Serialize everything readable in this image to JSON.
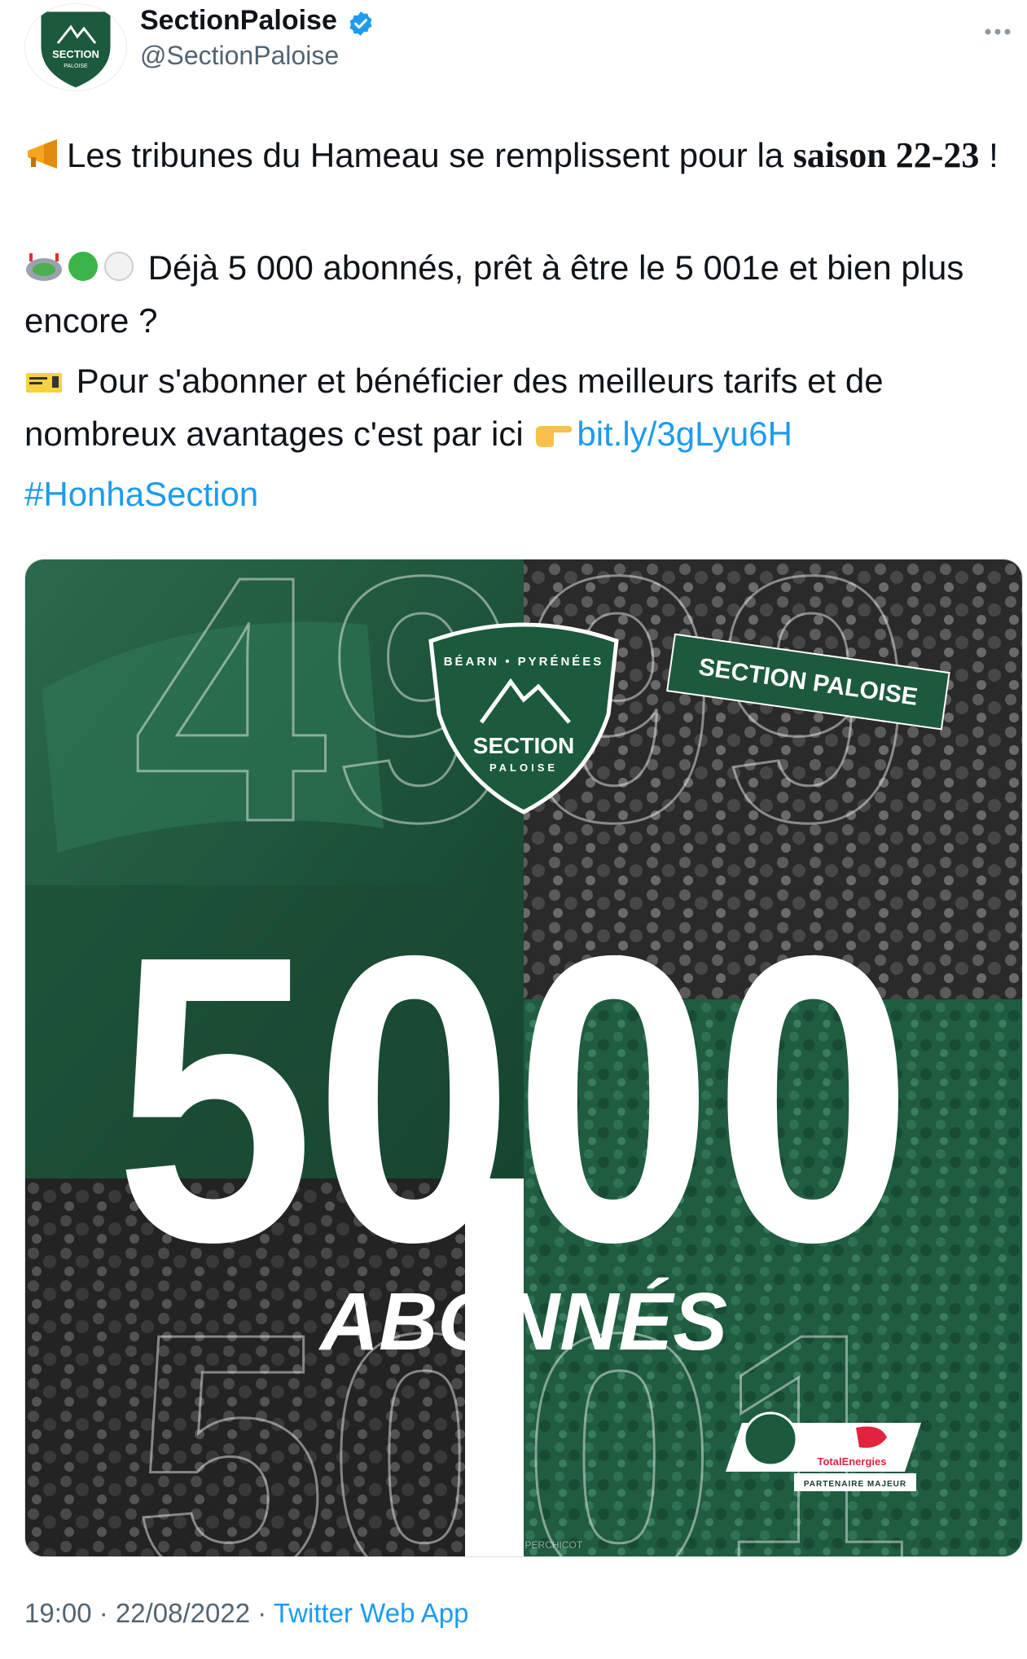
{
  "account": {
    "display_name": "SectionPaloise",
    "handle": "@SectionPaloise",
    "verified": true,
    "avatar_logo_text": "SECTION",
    "avatar_logo_sub": "PALOISE"
  },
  "tweet": {
    "line1_pre": "Les tribunes du Hameau se remplissent pour la ",
    "line1_bold": "saison 22-23",
    "line1_post": " !",
    "line2": "Déjà 5 000 abonnés, prêt à être le 5 001e et bien plus encore ?",
    "line3": "Pour s'abonner et bénéficier des meilleurs tarifs et de nombreux avantages c'est par ici",
    "link": "bit.ly/3gLyu6H",
    "hashtag": "#HonhaSection"
  },
  "media": {
    "big_number": "5000",
    "subtitle": "ABONNÉS",
    "ghost_digits_top": "4999",
    "ghost_digits_bottom": "5001",
    "badge_top": "BÉARN • PYRÉNÉES",
    "badge_main": "SECTION",
    "badge_sub": "PALOISE",
    "scarf_text": "SECTION PALOISE",
    "sponsor": "TotalEnergies",
    "partner_label": "PARTENAIRE MAJEUR",
    "photo_credit": "©Romain PERCHICOT"
  },
  "footer": {
    "time": "19:00",
    "date": "22/08/2022",
    "separator": " · ",
    "source": "Twitter Web App"
  },
  "colors": {
    "brand_green": "#1f5c40",
    "dark_green": "#0f3d29",
    "link_blue": "#1d9bf0",
    "muted": "#536471"
  }
}
